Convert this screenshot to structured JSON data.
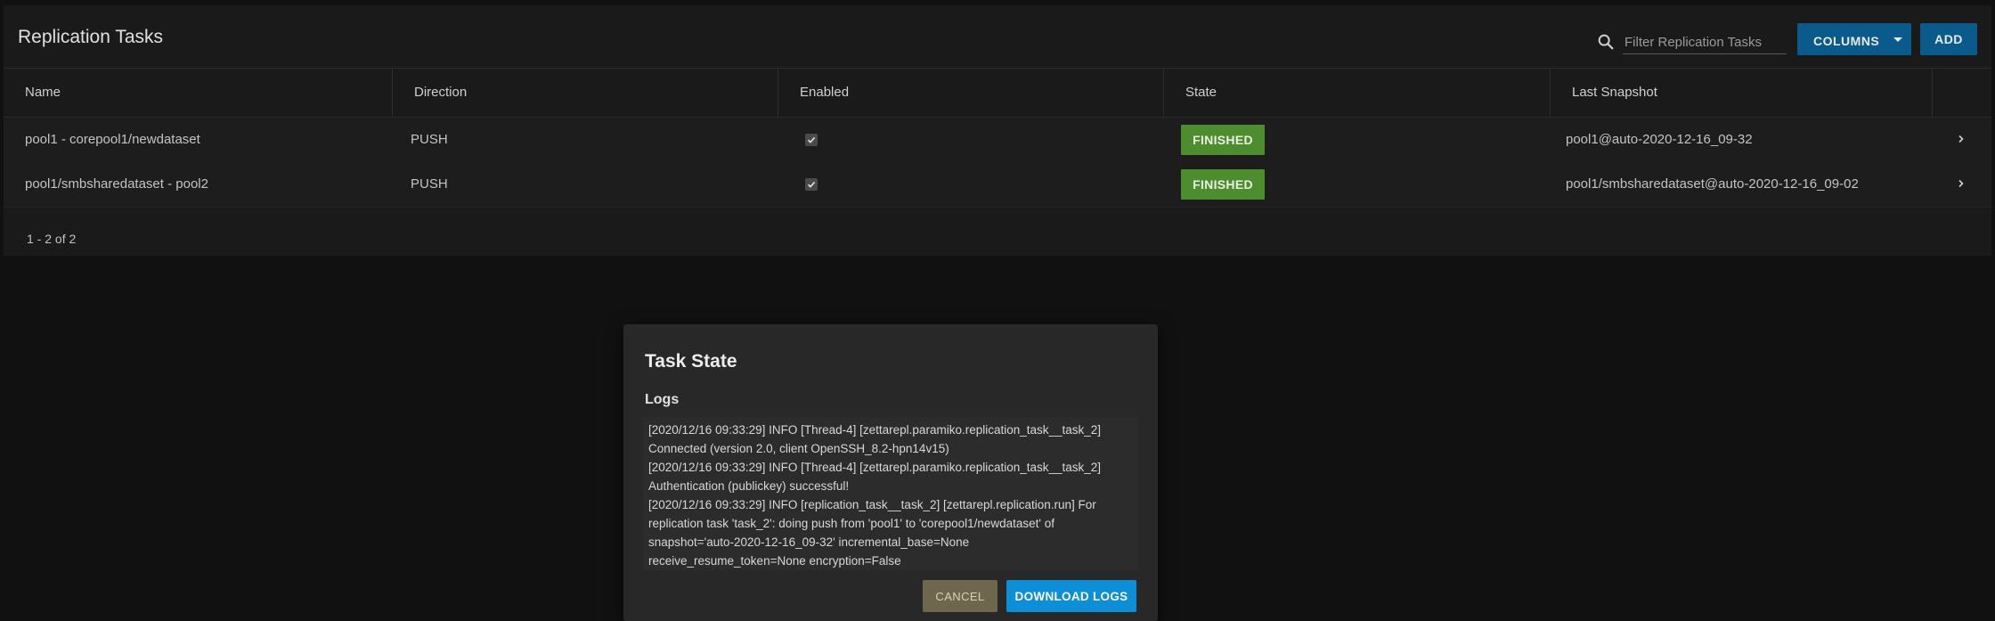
{
  "card": {
    "title": "Replication Tasks"
  },
  "search": {
    "placeholder": "Filter Replication Tasks",
    "value": ""
  },
  "toolbar": {
    "columns_label": "COLUMNS",
    "add_label": "ADD"
  },
  "table": {
    "columns": [
      "Name",
      "Direction",
      "Enabled",
      "State",
      "Last Snapshot"
    ],
    "rows": [
      {
        "name": "pool1 - corepool1/newdataset",
        "direction": "PUSH",
        "enabled": true,
        "state": "FINISHED",
        "last_snapshot": "pool1@auto-2020-12-16_09-32"
      },
      {
        "name": "pool1/smbsharedataset - pool2",
        "direction": "PUSH",
        "enabled": true,
        "state": "FINISHED",
        "last_snapshot": "pool1/smbsharedataset@auto-2020-12-16_09-02"
      }
    ],
    "pager": "1 - 2 of 2"
  },
  "dialog": {
    "title": "Task State",
    "logs_label": "Logs",
    "log_lines": [
      "[2020/12/16 09:33:29] INFO     [Thread-4] [zettarepl.paramiko.replication_task__task_2]",
      "Connected (version 2.0, client OpenSSH_8.2-hpn14v15)",
      "[2020/12/16 09:33:29] INFO     [Thread-4] [zettarepl.paramiko.replication_task__task_2]",
      "Authentication (publickey) successful!",
      "[2020/12/16 09:33:29] INFO     [replication_task__task_2] [zettarepl.replication.run] For",
      "replication task 'task_2': doing push from 'pool1' to 'corepool1/newdataset' of",
      "snapshot='auto-2020-12-16_09-32' incremental_base=None",
      "receive_resume_token=None encryption=False"
    ],
    "cancel_label": "CANCEL",
    "download_label": "DOWNLOAD LOGS"
  },
  "colors": {
    "accent": "#0a5a8c",
    "primary_button": "#0d8fd8",
    "status_finished": "#4d8c2f",
    "cancel_button": "#6e674e"
  }
}
